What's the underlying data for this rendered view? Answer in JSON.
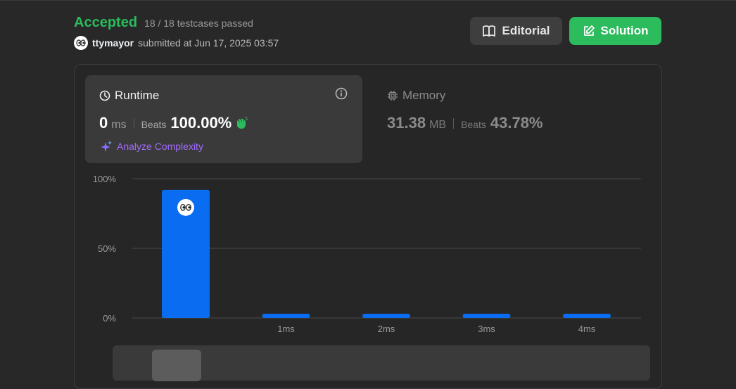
{
  "status": {
    "result": "Accepted",
    "testcases": "18 / 18 testcases passed",
    "username": "ttymayor",
    "submitted_text": "submitted at Jun 17, 2025 03:57"
  },
  "buttons": {
    "editorial": "Editorial",
    "solution": "Solution"
  },
  "runtime": {
    "title": "Runtime",
    "value": "0",
    "unit": "ms",
    "beats_label": "Beats",
    "beats": "100.00%",
    "analyze": "Analyze Complexity"
  },
  "memory": {
    "title": "Memory",
    "value": "31.38",
    "unit": "MB",
    "beats_label": "Beats",
    "beats": "43.78%"
  },
  "colors": {
    "accepted": "#2cbb5d",
    "bar": "#0a6cf0",
    "analyze": "#a36bff"
  },
  "chart_data": {
    "type": "bar",
    "categories": [
      "0ms",
      "1ms",
      "2ms",
      "3ms",
      "4ms"
    ],
    "tick_labels": [
      "",
      "1ms",
      "2ms",
      "3ms",
      "4ms"
    ],
    "values": [
      92,
      3,
      3,
      3,
      3
    ],
    "y_ticks": [
      "100%",
      "50%",
      "0%"
    ],
    "y_tick_values": [
      100,
      50,
      0
    ],
    "ylim": [
      0,
      100
    ],
    "grid": true,
    "highlight_index": 0
  }
}
